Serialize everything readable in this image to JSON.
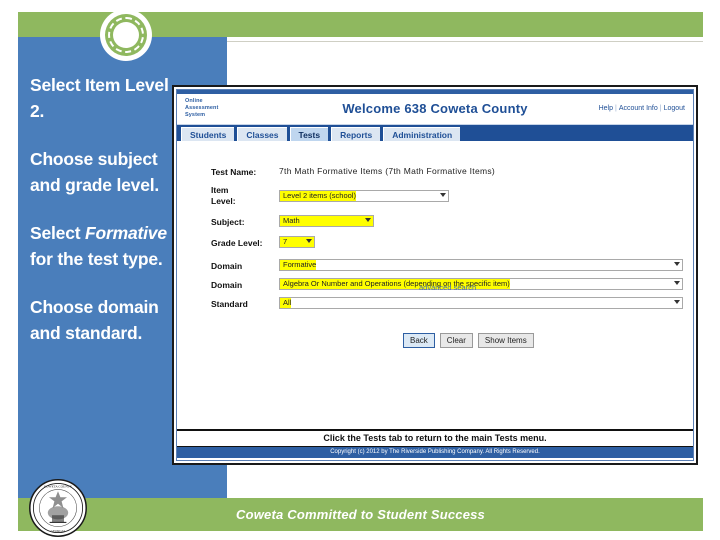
{
  "slide": {
    "accent_green": "#8fb85f",
    "accent_blue": "#4a7ebb",
    "highlight_yellow": "#ffff00",
    "tagline": "Coweta Committed to Student Success",
    "seal_alt": "coweta-county-seal"
  },
  "sidebar": {
    "paragraphs": [
      "Select Item Level 2.",
      "Choose subject and grade level.",
      "Choose domain and standard."
    ],
    "formative_instruction": {
      "before": "Select ",
      "emphasis": "Formative",
      "after": " for the test type."
    }
  },
  "app": {
    "logo_line1": "Online",
    "logo_line2": "Assessment",
    "logo_line3": "System",
    "welcome": "Welcome 638 Coweta County",
    "links": {
      "help": "Help",
      "account_info": "Account Info",
      "logout": "Logout"
    },
    "tabs": [
      {
        "label": "Students",
        "active": false
      },
      {
        "label": "Classes",
        "active": false
      },
      {
        "label": "Tests",
        "active": true
      },
      {
        "label": "Reports",
        "active": false
      },
      {
        "label": "Administration",
        "active": false
      }
    ],
    "form": {
      "test_name_label": "Test Name:",
      "test_name_value": "7th Math Formative Items (7th Math Formative Items)",
      "item_level_label_line1": "Item",
      "item_level_label_line2": "Level:",
      "item_level_value": "Level 2 items (school)",
      "subject_label": "Subject:",
      "subject_value": "Math",
      "grade_label": "Grade Level:",
      "grade_value": "7",
      "domain_type_label": "Domain",
      "domain_type_value": "Formative",
      "domain_label": "Domain",
      "domain_value": "Algebra Or Number and Operations (depending on the specific item)",
      "standard_label": "Standard",
      "standard_value": "All",
      "advanced_search": "advanced search"
    },
    "buttons": {
      "back": "Back",
      "clear": "Clear",
      "show_items": "Show Items"
    },
    "note": "Click the Tests tab to return to the main Tests menu.",
    "copyright": "Copyright (c) 2012 by The Riverside Publishing Company. All Rights Reserved."
  }
}
